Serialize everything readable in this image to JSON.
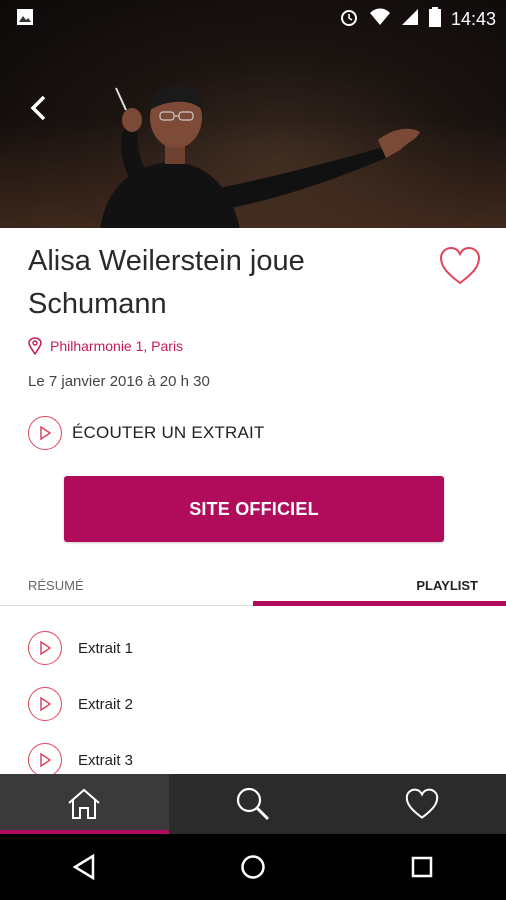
{
  "status_bar": {
    "time": "14:43"
  },
  "event": {
    "title": "Alisa Weilerstein joue Schumann",
    "venue": "Philharmonie 1, Paris",
    "date": "Le 7 janvier 2016 à 20 h 30",
    "listen_label": "ÉCOUTER UN EXTRAIT",
    "site_button": "SITE OFFICIEL"
  },
  "tabs": [
    {
      "label": "RÉSUMÉ",
      "active": false
    },
    {
      "label": "PLAYLIST",
      "active": true
    }
  ],
  "playlist": [
    {
      "label": "Extrait 1"
    },
    {
      "label": "Extrait 2"
    },
    {
      "label": "Extrait 3"
    }
  ],
  "bottom_nav": [
    {
      "icon": "home-icon",
      "active": true
    },
    {
      "icon": "search-icon",
      "active": false
    },
    {
      "icon": "heart-icon",
      "active": false
    }
  ],
  "colors": {
    "accent": "#b10c5c",
    "accent_light": "#e0455e",
    "nav_bg": "#2b2b2b"
  }
}
